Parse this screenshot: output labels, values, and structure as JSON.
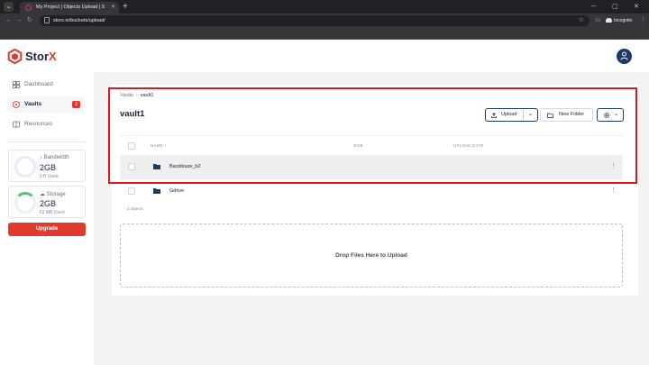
{
  "browser": {
    "tab_title": "My Project | Objects Upload | S",
    "url": "storx.io/buckets/upload/",
    "incognito_label": "Incognito"
  },
  "brand": {
    "name_main": "Stor",
    "name_accent": "X"
  },
  "sidebar": {
    "items": [
      {
        "label": "Dashboard",
        "icon": "dashboard-icon"
      },
      {
        "label": "Vaults",
        "icon": "vault-icon",
        "badge": "2"
      },
      {
        "label": "Resources",
        "icon": "resources-icon"
      }
    ],
    "bandwidth": {
      "title": "Bandwidth",
      "value": "2GB",
      "used": "0 B Used",
      "fraction_used": 0
    },
    "storage": {
      "title": "Storage",
      "value": "2GB",
      "used": "62 MB Used"
    },
    "upgrade_label": "Upgrade"
  },
  "main": {
    "breadcrumb": [
      "Vaults",
      "vault1"
    ],
    "title": "vault1",
    "buttons": {
      "upload": "Upload",
      "new_folder": "New Folder"
    },
    "table": {
      "columns": [
        "NAME",
        "SIZE",
        "UPLOAD DATE"
      ],
      "rows": [
        {
          "name": "Backblaze_b2",
          "type": "folder"
        },
        {
          "name": "Gdrive",
          "type": "folder"
        }
      ]
    },
    "object_count": "2 objects",
    "dropzone_text": "Drop Files Here to Upload"
  },
  "colors": {
    "brand": "#e0392e",
    "navy": "#1b3a6b",
    "highlight": "#d11d1d"
  }
}
